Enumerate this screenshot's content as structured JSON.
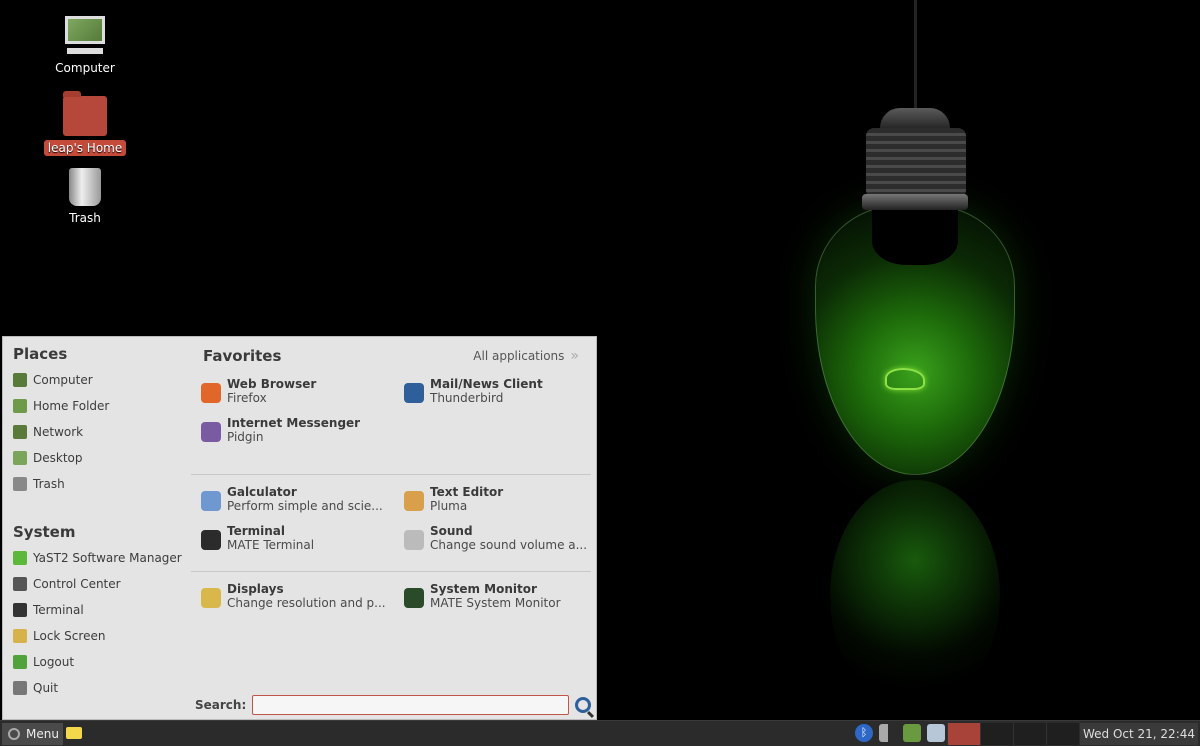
{
  "desktop": {
    "icons": [
      {
        "label": "Computer",
        "icon": "computer-icon"
      },
      {
        "label": "leap's Home",
        "icon": "home-folder-icon",
        "selected": true
      },
      {
        "label": "Trash",
        "icon": "trash-icon"
      }
    ]
  },
  "menu": {
    "places": {
      "title": "Places",
      "items": [
        {
          "label": "Computer",
          "icon": "computer-icon",
          "color": "#5a7a3a"
        },
        {
          "label": "Home Folder",
          "icon": "home-folder-icon",
          "color": "#6f9a4a"
        },
        {
          "label": "Network",
          "icon": "network-icon",
          "color": "#5a7a3a"
        },
        {
          "label": "Desktop",
          "icon": "desktop-folder-icon",
          "color": "#7aa55a"
        },
        {
          "label": "Trash",
          "icon": "trash-icon",
          "color": "#888888"
        }
      ]
    },
    "system": {
      "title": "System",
      "items": [
        {
          "label": "YaST2 Software Manager",
          "icon": "yast-icon",
          "color": "#5cb83a"
        },
        {
          "label": "Control Center",
          "icon": "control-center-icon",
          "color": "#555555"
        },
        {
          "label": "Terminal",
          "icon": "terminal-icon",
          "color": "#333333"
        },
        {
          "label": "Lock Screen",
          "icon": "lock-screen-icon",
          "color": "#d6b24a"
        },
        {
          "label": "Logout",
          "icon": "logout-icon",
          "color": "#4fa33a"
        },
        {
          "label": "Quit",
          "icon": "quit-icon",
          "color": "#777777"
        }
      ]
    },
    "favorites": {
      "title": "Favorites",
      "all_apps_label": "All applications",
      "groups": [
        [
          {
            "name": "Web Browser",
            "desc": "Firefox",
            "icon": "firefox-icon",
            "color": "#e0662a"
          },
          {
            "name": "Mail/News Client",
            "desc": "Thunderbird",
            "icon": "thunderbird-icon",
            "color": "#2f5f9b"
          },
          {
            "name": "Internet Messenger",
            "desc": "Pidgin",
            "icon": "pidgin-icon",
            "color": "#7a5aa0"
          }
        ],
        [
          {
            "name": "Galculator",
            "desc": "Perform simple and scie...",
            "icon": "calculator-icon",
            "color": "#6f98d0"
          },
          {
            "name": "Text Editor",
            "desc": "Pluma",
            "icon": "text-editor-icon",
            "color": "#d8a04a"
          },
          {
            "name": "Terminal",
            "desc": "MATE Terminal",
            "icon": "terminal-icon",
            "color": "#2b2b2b"
          },
          {
            "name": "Sound",
            "desc": "Change sound volume a...",
            "icon": "sound-icon",
            "color": "#bbbbbb"
          }
        ],
        [
          {
            "name": "Displays",
            "desc": "Change resolution and p...",
            "icon": "displays-icon",
            "color": "#d8b84a"
          },
          {
            "name": "System Monitor",
            "desc": "MATE System Monitor",
            "icon": "system-monitor-icon",
            "color": "#2a4a2a"
          }
        ]
      ]
    },
    "search": {
      "label": "Search:",
      "value": "",
      "placeholder": ""
    }
  },
  "taskbar": {
    "menu_label": "Menu",
    "tray": [
      "bluetooth-icon",
      "volume-icon",
      "network-icon",
      "power-icon"
    ],
    "bluetooth_glyph": "ᛒ",
    "workspaces": [
      {
        "active": true
      },
      {
        "active": false
      },
      {
        "active": false
      },
      {
        "active": false
      }
    ],
    "clock": "Wed Oct 21, 22:44"
  }
}
